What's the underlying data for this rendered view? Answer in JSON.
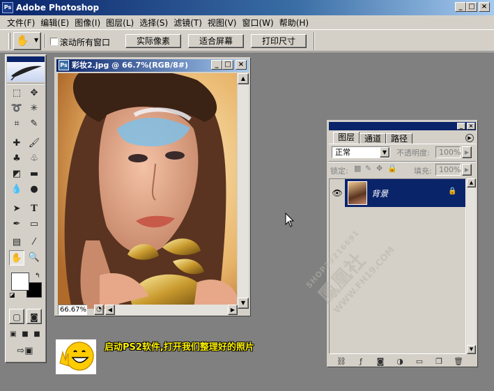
{
  "app": {
    "title": "Adobe Photoshop"
  },
  "menu": [
    "文件(F)",
    "编辑(E)",
    "图像(I)",
    "图层(L)",
    "选择(S)",
    "滤镜(T)",
    "视图(V)",
    "窗口(W)",
    "帮助(H)"
  ],
  "options": {
    "scroll_all_label": "滚动所有窗口",
    "actual_pixels": "实际像素",
    "fit_screen": "适合屏幕",
    "print_size": "打印尺寸"
  },
  "document": {
    "title": "彩妆2.jpg @ 66.7%(RGB/8#)",
    "zoom": "66.67%"
  },
  "layers_panel": {
    "tabs": [
      "图层",
      "通道",
      "路径"
    ],
    "blend_mode": "正常",
    "opacity_label": "不透明度:",
    "opacity_value": "100%",
    "lock_label": "锁定:",
    "fill_label": "填充:",
    "fill_value": "100%",
    "layer_name": "背景"
  },
  "caption": "启动PS2软件,打开我们整理好的照片",
  "watermark": {
    "line1": "SHOP35216691",
    "line2": "鳳凰社",
    "line3": "WWW.FH19.COM"
  },
  "colors": {
    "title_active": "#0a246a",
    "desktop": "#808080",
    "caption": "#fff200",
    "selected_layer": "#0a246a"
  }
}
